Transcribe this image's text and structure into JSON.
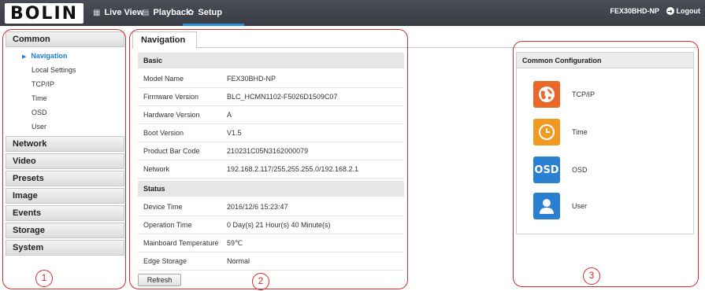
{
  "header": {
    "logo_text": "BOLIN",
    "nav": [
      {
        "label": "Live View",
        "icon": "live-view-icon"
      },
      {
        "label": "Playback",
        "icon": "playback-icon"
      },
      {
        "label": "Setup",
        "icon": "gear-icon"
      }
    ],
    "device_name": "FEX30BHD-NP",
    "logout_label": "Logout",
    "active_color": "#2f8fd6"
  },
  "sidebar": {
    "common": {
      "label": "Common",
      "items": [
        "Navigation",
        "Local Settings",
        "TCP/IP",
        "Time",
        "OSD",
        "User"
      ],
      "active": "Navigation"
    },
    "sections": [
      "Network",
      "Video",
      "Presets",
      "Image",
      "Events",
      "Storage",
      "System"
    ]
  },
  "main": {
    "tab": "Navigation",
    "basic": {
      "title": "Basic",
      "rows": [
        {
          "k": "Model Name",
          "v": "FEX30BHD-NP"
        },
        {
          "k": "Firmware Version",
          "v": "BLC_HCMN1102-F5026D1509C07"
        },
        {
          "k": "Hardware Version",
          "v": "A"
        },
        {
          "k": "Boot Version",
          "v": "V1.5"
        },
        {
          "k": "Product Bar Code",
          "v": "210231C05N3162000079"
        },
        {
          "k": "Network",
          "v": "192.168.2.117/255.255.255.0/192.168.2.1"
        }
      ]
    },
    "status": {
      "title": "Status",
      "rows": [
        {
          "k": "Device Time",
          "v": "2016/12/6 15:23:47"
        },
        {
          "k": "Operation Time",
          "v": "0 Day(s) 21 Hour(s) 40 Minute(s)"
        },
        {
          "k": "Mainboard Temperature",
          "v": "59℃"
        },
        {
          "k": "Edge Storage",
          "v": "Normal"
        }
      ]
    },
    "refresh_label": "Refresh"
  },
  "config": {
    "title": "Common Configuration",
    "items": [
      {
        "label": "TCP/IP",
        "icon": "globe-icon",
        "color": "#e8672a"
      },
      {
        "label": "Time",
        "icon": "clock-icon",
        "color": "#f19a22"
      },
      {
        "label": "OSD",
        "icon": "osd-icon",
        "color": "#2a7fd0",
        "text": "OSD"
      },
      {
        "label": "User",
        "icon": "user-icon",
        "color": "#2a7fd0"
      }
    ]
  },
  "annotations": [
    "1",
    "2",
    "3"
  ]
}
